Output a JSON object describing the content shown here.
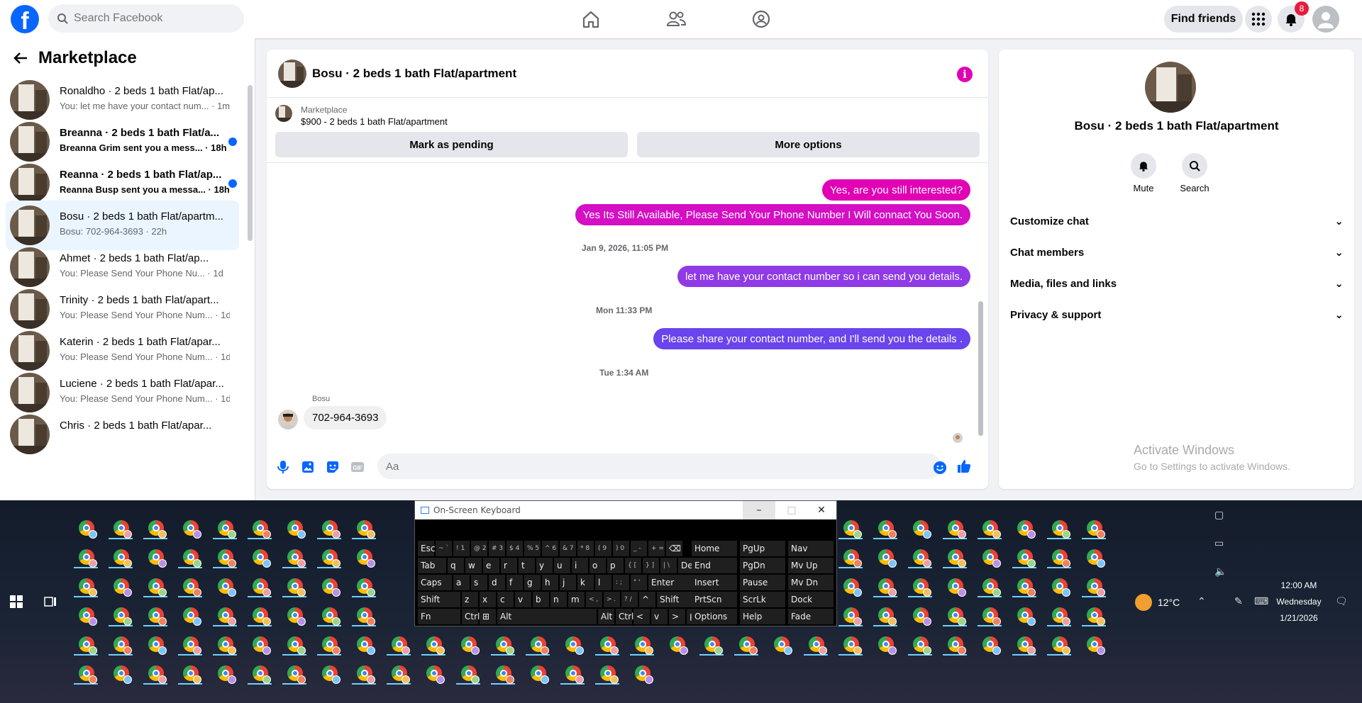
{
  "topbar": {
    "logo": "f",
    "search_placeholder": "Search Facebook",
    "find_friends": "Find friends",
    "notif_count": "8"
  },
  "marketplace": {
    "title": "Marketplace",
    "conversations": [
      {
        "title": "Ronaldho · 2 beds 1 bath Flat/ap...",
        "snippet": "You: let me have your contact num... · 1m",
        "unread": false,
        "active": false
      },
      {
        "title": "Breanna · 2 beds 1 bath Flat/a...",
        "snippet": "Breanna Grim sent you a mess... · 18h",
        "unread": true,
        "active": false
      },
      {
        "title": "Reanna · 2 beds 1 bath Flat/ap...",
        "snippet": "Reanna Busp sent you a messa... · 18h",
        "unread": true,
        "active": false
      },
      {
        "title": "Bosu · 2 beds 1 bath Flat/apartm...",
        "snippet": "Bosu: 702-964-3693 · 22h",
        "unread": false,
        "active": true
      },
      {
        "title": "Ahmet · 2 beds 1 bath Flat/ap...",
        "snippet": "You: Please Send Your Phone Nu... · 1d",
        "unread": false,
        "active": false
      },
      {
        "title": "Trinity · 2 beds 1 bath Flat/apart...",
        "snippet": "You: Please Send Your Phone Num... · 1d",
        "unread": false,
        "active": false
      },
      {
        "title": "Katerin · 2 beds 1 bath Flat/apar...",
        "snippet": "You: Please Send Your Phone Num... · 1d",
        "unread": false,
        "active": false
      },
      {
        "title": "Luciene · 2 beds 1 bath Flat/apar...",
        "snippet": "You: Please Send Your Phone Num... · 1d",
        "unread": false,
        "active": false
      },
      {
        "title": "Chris · 2 beds 1 bath Flat/apar...",
        "snippet": "",
        "unread": false,
        "active": false
      }
    ]
  },
  "chat": {
    "title": "Bosu · 2 beds 1 bath Flat/apartment",
    "mp_label": "Marketplace",
    "mp_price": "$900 - 2 beds 1 bath Flat/apartment",
    "mark_pending": "Mark as pending",
    "more_options": "More options",
    "messages": [
      {
        "text": "Yes, are you still interested?"
      },
      {
        "text": "Yes Its Still Available, Please Send Your Phone Number I Will connact You Soon."
      },
      {
        "text": "let me have your contact number so i can send you details."
      },
      {
        "text": "Please share your contact number, and I'll send you the details ."
      }
    ],
    "timestamps": [
      "Jan 9, 2026, 11:05 PM",
      "Mon 11:33 PM",
      "Tue 1:34 AM"
    ],
    "incoming_sender": "Bosu",
    "incoming_text": "702-964-3693",
    "composer_placeholder": "Aa"
  },
  "info": {
    "name": "Bosu · 2 beds 1 bath Flat/apartment",
    "mute": "Mute",
    "search": "Search",
    "sections": [
      "Customize chat",
      "Chat members",
      "Media, files and links",
      "Privacy & support"
    ],
    "activate_title": "Activate Windows",
    "activate_sub": "Go to Settings to activate Windows."
  },
  "osk": {
    "title": "On-Screen Keyboard",
    "rows": [
      [
        "Esc",
        "~ `",
        "! 1",
        "@ 2",
        "# 3",
        "$ 4",
        "% 5",
        "^ 6",
        "& 7",
        "* 8",
        "( 9",
        ") 0",
        "_ -",
        "+ =",
        "⌫"
      ],
      [
        "Tab",
        "q",
        "w",
        "e",
        "r",
        "t",
        "y",
        "u",
        "i",
        "o",
        "p",
        "{ [",
        "} ]",
        "| \\",
        "Del"
      ],
      [
        "Caps",
        "a",
        "s",
        "d",
        "f",
        "g",
        "h",
        "j",
        "k",
        "l",
        ": ;",
        "\" '",
        "Enter"
      ],
      [
        "Shift",
        "z",
        "x",
        "c",
        "v",
        "b",
        "n",
        "m",
        "< ,",
        "> .",
        "? /",
        "^",
        "Shift"
      ],
      [
        "Fn",
        "Ctrl",
        "⊞",
        "Alt",
        "Alt",
        "Ctrl",
        "<",
        "v",
        ">",
        "▤"
      ]
    ],
    "nav_keys": [
      "Home",
      "PgUp",
      "Nav",
      "End",
      "PgDn",
      "Mv Up",
      "Insert",
      "Pause",
      "Mv Dn",
      "PrtScn",
      "ScrLk",
      "Dock",
      "Options",
      "Help",
      "Fade"
    ]
  },
  "tray": {
    "temp": "12°C",
    "time": "12:00 AM",
    "day": "Wednesday",
    "date": "1/21/2026"
  },
  "colors": {
    "fb_blue": "#0866ff",
    "msg_pink": "#e100b4",
    "msg_violet": "#8f3ae6",
    "msg_indigo": "#6a44ec"
  }
}
